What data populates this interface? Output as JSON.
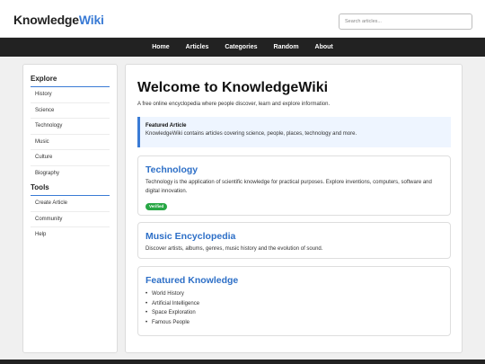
{
  "header": {
    "logo_part1": "Knowledge",
    "logo_part2": "Wiki",
    "search_placeholder": "Search articles..."
  },
  "nav": {
    "items": [
      "Home",
      "Articles",
      "Categories",
      "Random",
      "About"
    ]
  },
  "sidebar": {
    "explore_heading": "Explore",
    "explore_items": [
      "History",
      "Science",
      "Technology",
      "Music",
      "Culture",
      "Biography"
    ],
    "tools_heading": "Tools",
    "tools_items": [
      "Create Article",
      "Community",
      "Help"
    ]
  },
  "main": {
    "title": "Welcome to KnowledgeWiki",
    "subtitle": "A free online encyclopedia where people discover, learn and explore information.",
    "featured": {
      "heading": "Featured Article",
      "text": "KnowledgeWiki contains articles covering science, people, places, technology and more."
    },
    "cards": [
      {
        "title": "Technology",
        "text": "Technology is the application of scientific knowledge for practical purposes. Explore inventions, computers, software and digital innovation.",
        "badge": "Verified"
      },
      {
        "title": "Music Encyclopedia",
        "text": "Discover artists, albums, genres, music history and the evolution of sound."
      },
      {
        "title": "Featured Knowledge",
        "list": [
          "World History",
          "Artificial Intelligence",
          "Space Exploration",
          "Famous People"
        ]
      }
    ]
  },
  "colors": {
    "accent": "#3a7bd5",
    "nav_bg": "#222222",
    "badge": "#28a745"
  }
}
